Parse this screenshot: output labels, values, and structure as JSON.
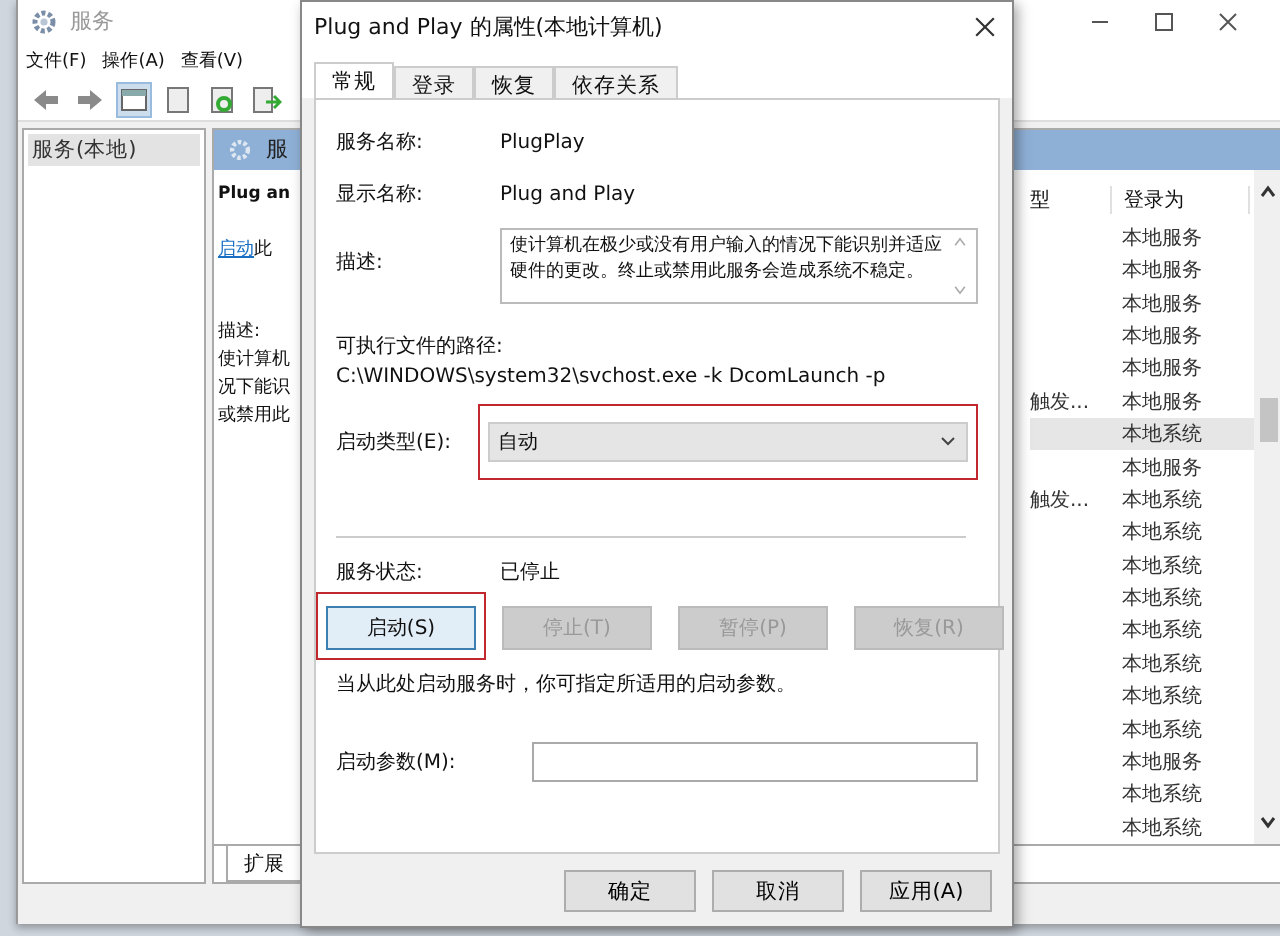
{
  "services_window": {
    "title": "服务",
    "menu": [
      "文件(F)",
      "操作(A)",
      "查看(V)"
    ],
    "tree": [
      {
        "label": "服务(本地)",
        "selected": true
      }
    ],
    "detail": {
      "header": "服",
      "name": "Plug an",
      "link": "启动",
      "link_rest": "此",
      "description_label": "描述:",
      "description_lines": [
        "使计算机",
        "况下能识",
        "或禁用此"
      ]
    },
    "list": {
      "columns": [
        "型",
        "登录为"
      ],
      "rows": [
        {
          "login": "本地服务",
          "selected": false
        },
        {
          "login": "本地服务",
          "selected": false
        },
        {
          "login": "本地服务",
          "selected": false
        },
        {
          "login": "本地服务",
          "selected": false
        },
        {
          "login": "本地服务",
          "selected": false
        },
        {
          "type": "触发...",
          "login": "本地服务",
          "selected": false
        },
        {
          "login": "本地系统",
          "selected": true
        },
        {
          "login": "本地服务",
          "selected": false
        },
        {
          "type": "触发...",
          "login": "本地系统",
          "selected": false
        },
        {
          "login": "本地系统",
          "selected": false
        },
        {
          "login": "本地系统",
          "selected": false
        },
        {
          "login": "本地系统",
          "selected": false
        },
        {
          "login": "本地系统",
          "selected": false
        },
        {
          "login": "本地系统",
          "selected": false
        },
        {
          "login": "本地系统",
          "selected": false
        },
        {
          "login": "本地系统",
          "selected": false
        },
        {
          "login": "本地服务",
          "selected": false
        },
        {
          "login": "本地系统",
          "selected": false
        },
        {
          "login": "本地系统",
          "selected": false
        }
      ]
    },
    "tabs": [
      {
        "label": "扩展",
        "selected": true
      }
    ]
  },
  "dialog": {
    "title": "Plug and Play 的属性(本地计算机)",
    "tabs": [
      {
        "label": "常规",
        "selected": true
      },
      {
        "label": "登录",
        "selected": false
      },
      {
        "label": "恢复",
        "selected": false
      },
      {
        "label": "依存关系",
        "selected": false
      }
    ],
    "service_name": {
      "label": "服务名称:",
      "value": "PlugPlay"
    },
    "display_name": {
      "label": "显示名称:",
      "value": "Plug and Play"
    },
    "description": {
      "label": "描述:",
      "value": "使计算机在极少或没有用户输入的情况下能识别并适应硬件的更改。终止或禁用此服务会造成系统不稳定。"
    },
    "path": {
      "label": "可执行文件的路径:",
      "value": "C:\\WINDOWS\\system32\\svchost.exe -k DcomLaunch -p"
    },
    "startup_type": {
      "label": "启动类型(E):",
      "value": "自动",
      "highlighted": true
    },
    "service_status": {
      "label": "服务状态:",
      "value": "已停止"
    },
    "control_buttons": [
      {
        "label": "启动(S)",
        "disabled": false,
        "highlighted": true
      },
      {
        "label": "停止(T)",
        "disabled": true,
        "highlighted": false
      },
      {
        "label": "暂停(P)",
        "disabled": true,
        "highlighted": false
      },
      {
        "label": "恢复(R)",
        "disabled": true,
        "highlighted": false
      }
    ],
    "hint": "当从此处启动服务时，你可指定所适用的启动参数。",
    "start_params": {
      "label": "启动参数(M):"
    },
    "footer_buttons": [
      {
        "label": "确定"
      },
      {
        "label": "取消"
      },
      {
        "label": "应用(A)"
      }
    ]
  }
}
